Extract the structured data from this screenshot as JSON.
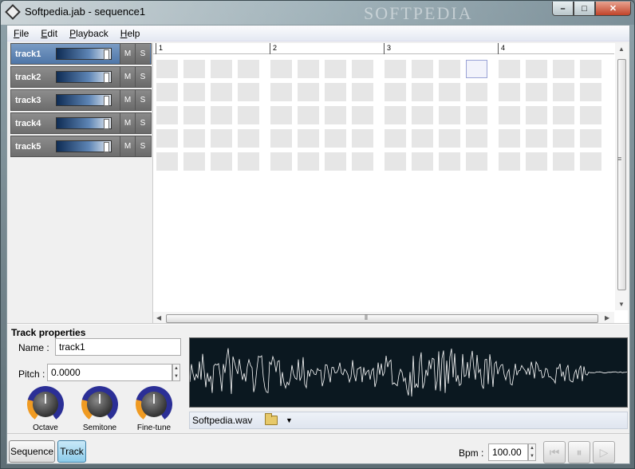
{
  "window": {
    "title": "Softpedia.jab - sequence1",
    "watermark": "SOFTPEDIA",
    "minimize": "–",
    "maximize": "□",
    "close": "✕"
  },
  "menu": {
    "file": "File",
    "file_u": "F",
    "file_rest": "ile",
    "edit": "Edit",
    "edit_u": "E",
    "edit_rest": "dit",
    "playback": "Playback",
    "playback_u": "P",
    "playback_rest": "layback",
    "help": "Help",
    "help_u": "H",
    "help_rest": "elp"
  },
  "tracks": [
    {
      "name": "track1",
      "mute": "M",
      "solo": "S",
      "selected": true
    },
    {
      "name": "track2",
      "mute": "M",
      "solo": "S",
      "selected": false
    },
    {
      "name": "track3",
      "mute": "M",
      "solo": "S",
      "selected": false
    },
    {
      "name": "track4",
      "mute": "M",
      "solo": "S",
      "selected": false
    },
    {
      "name": "track5",
      "mute": "M",
      "solo": "S",
      "selected": false
    }
  ],
  "ruler": [
    "1",
    "2",
    "3",
    "4"
  ],
  "grid": {
    "rows": 5,
    "bars": 4,
    "steps_per_bar": 4,
    "selected_row": 1,
    "selected_step": 11
  },
  "track_properties": {
    "title": "Track properties",
    "name_label": "Name :",
    "name_value": "track1",
    "pitch_label": "Pitch :",
    "pitch_value": "0.0000",
    "knobs": [
      "Octave",
      "Semitone",
      "Fine-tune"
    ],
    "sample_file": "Softpedia.wav"
  },
  "bottom": {
    "sequence_tab": "Sequence",
    "track_tab": "Track",
    "active_tab": "Track",
    "bpm_label": "Bpm :",
    "bpm_value": "100.00",
    "rewind_icon": "⏮",
    "pause_icon": "⏸",
    "play_icon": "▷"
  },
  "colors": {
    "selected_track": "#4e76a8",
    "track": "#6d6d6d",
    "knob_accent": "#f09b22",
    "knob_ring": "#2b2f96",
    "waveform": "#ffffff",
    "waveform_bg": "#0b1820"
  }
}
